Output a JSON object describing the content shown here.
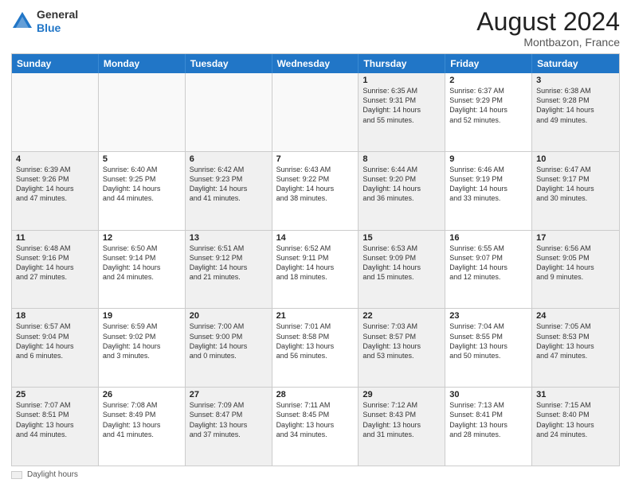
{
  "logo": {
    "general": "General",
    "blue": "Blue"
  },
  "header": {
    "month": "August 2024",
    "location": "Montbazon, France"
  },
  "weekdays": [
    "Sunday",
    "Monday",
    "Tuesday",
    "Wednesday",
    "Thursday",
    "Friday",
    "Saturday"
  ],
  "legend": {
    "label": "Daylight hours"
  },
  "rows": [
    [
      {
        "day": "",
        "text": "",
        "empty": true
      },
      {
        "day": "",
        "text": "",
        "empty": true
      },
      {
        "day": "",
        "text": "",
        "empty": true
      },
      {
        "day": "",
        "text": "",
        "empty": true
      },
      {
        "day": "1",
        "text": "Sunrise: 6:35 AM\nSunset: 9:31 PM\nDaylight: 14 hours\nand 55 minutes.",
        "shaded": true
      },
      {
        "day": "2",
        "text": "Sunrise: 6:37 AM\nSunset: 9:29 PM\nDaylight: 14 hours\nand 52 minutes."
      },
      {
        "day": "3",
        "text": "Sunrise: 6:38 AM\nSunset: 9:28 PM\nDaylight: 14 hours\nand 49 minutes.",
        "shaded": true
      }
    ],
    [
      {
        "day": "4",
        "text": "Sunrise: 6:39 AM\nSunset: 9:26 PM\nDaylight: 14 hours\nand 47 minutes.",
        "shaded": true
      },
      {
        "day": "5",
        "text": "Sunrise: 6:40 AM\nSunset: 9:25 PM\nDaylight: 14 hours\nand 44 minutes."
      },
      {
        "day": "6",
        "text": "Sunrise: 6:42 AM\nSunset: 9:23 PM\nDaylight: 14 hours\nand 41 minutes.",
        "shaded": true
      },
      {
        "day": "7",
        "text": "Sunrise: 6:43 AM\nSunset: 9:22 PM\nDaylight: 14 hours\nand 38 minutes."
      },
      {
        "day": "8",
        "text": "Sunrise: 6:44 AM\nSunset: 9:20 PM\nDaylight: 14 hours\nand 36 minutes.",
        "shaded": true
      },
      {
        "day": "9",
        "text": "Sunrise: 6:46 AM\nSunset: 9:19 PM\nDaylight: 14 hours\nand 33 minutes."
      },
      {
        "day": "10",
        "text": "Sunrise: 6:47 AM\nSunset: 9:17 PM\nDaylight: 14 hours\nand 30 minutes.",
        "shaded": true
      }
    ],
    [
      {
        "day": "11",
        "text": "Sunrise: 6:48 AM\nSunset: 9:16 PM\nDaylight: 14 hours\nand 27 minutes.",
        "shaded": true
      },
      {
        "day": "12",
        "text": "Sunrise: 6:50 AM\nSunset: 9:14 PM\nDaylight: 14 hours\nand 24 minutes."
      },
      {
        "day": "13",
        "text": "Sunrise: 6:51 AM\nSunset: 9:12 PM\nDaylight: 14 hours\nand 21 minutes.",
        "shaded": true
      },
      {
        "day": "14",
        "text": "Sunrise: 6:52 AM\nSunset: 9:11 PM\nDaylight: 14 hours\nand 18 minutes."
      },
      {
        "day": "15",
        "text": "Sunrise: 6:53 AM\nSunset: 9:09 PM\nDaylight: 14 hours\nand 15 minutes.",
        "shaded": true
      },
      {
        "day": "16",
        "text": "Sunrise: 6:55 AM\nSunset: 9:07 PM\nDaylight: 14 hours\nand 12 minutes."
      },
      {
        "day": "17",
        "text": "Sunrise: 6:56 AM\nSunset: 9:05 PM\nDaylight: 14 hours\nand 9 minutes.",
        "shaded": true
      }
    ],
    [
      {
        "day": "18",
        "text": "Sunrise: 6:57 AM\nSunset: 9:04 PM\nDaylight: 14 hours\nand 6 minutes.",
        "shaded": true
      },
      {
        "day": "19",
        "text": "Sunrise: 6:59 AM\nSunset: 9:02 PM\nDaylight: 14 hours\nand 3 minutes."
      },
      {
        "day": "20",
        "text": "Sunrise: 7:00 AM\nSunset: 9:00 PM\nDaylight: 14 hours\nand 0 minutes.",
        "shaded": true
      },
      {
        "day": "21",
        "text": "Sunrise: 7:01 AM\nSunset: 8:58 PM\nDaylight: 13 hours\nand 56 minutes."
      },
      {
        "day": "22",
        "text": "Sunrise: 7:03 AM\nSunset: 8:57 PM\nDaylight: 13 hours\nand 53 minutes.",
        "shaded": true
      },
      {
        "day": "23",
        "text": "Sunrise: 7:04 AM\nSunset: 8:55 PM\nDaylight: 13 hours\nand 50 minutes."
      },
      {
        "day": "24",
        "text": "Sunrise: 7:05 AM\nSunset: 8:53 PM\nDaylight: 13 hours\nand 47 minutes.",
        "shaded": true
      }
    ],
    [
      {
        "day": "25",
        "text": "Sunrise: 7:07 AM\nSunset: 8:51 PM\nDaylight: 13 hours\nand 44 minutes.",
        "shaded": true
      },
      {
        "day": "26",
        "text": "Sunrise: 7:08 AM\nSunset: 8:49 PM\nDaylight: 13 hours\nand 41 minutes."
      },
      {
        "day": "27",
        "text": "Sunrise: 7:09 AM\nSunset: 8:47 PM\nDaylight: 13 hours\nand 37 minutes.",
        "shaded": true
      },
      {
        "day": "28",
        "text": "Sunrise: 7:11 AM\nSunset: 8:45 PM\nDaylight: 13 hours\nand 34 minutes."
      },
      {
        "day": "29",
        "text": "Sunrise: 7:12 AM\nSunset: 8:43 PM\nDaylight: 13 hours\nand 31 minutes.",
        "shaded": true
      },
      {
        "day": "30",
        "text": "Sunrise: 7:13 AM\nSunset: 8:41 PM\nDaylight: 13 hours\nand 28 minutes."
      },
      {
        "day": "31",
        "text": "Sunrise: 7:15 AM\nSunset: 8:40 PM\nDaylight: 13 hours\nand 24 minutes.",
        "shaded": true
      }
    ]
  ]
}
